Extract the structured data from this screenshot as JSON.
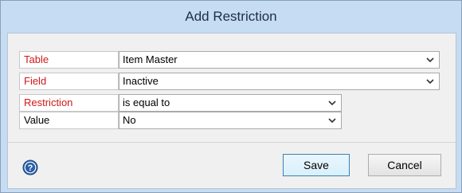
{
  "dialog": {
    "title": "Add Restriction"
  },
  "form": {
    "rows": [
      {
        "label": "Table",
        "value": "Item Master",
        "required": true
      },
      {
        "label": "Field",
        "value": "Inactive",
        "required": true
      },
      {
        "label": "Restriction",
        "value": "is equal to",
        "required": true
      },
      {
        "label": "Value",
        "value": "No",
        "required": false
      }
    ]
  },
  "footer": {
    "help_icon": "question-circle-icon",
    "save_label": "Save",
    "cancel_label": "Cancel"
  },
  "colors": {
    "required_label": "#d01818",
    "title_bar": "#c6dcf2",
    "help_icon": "#2a5ea8"
  }
}
